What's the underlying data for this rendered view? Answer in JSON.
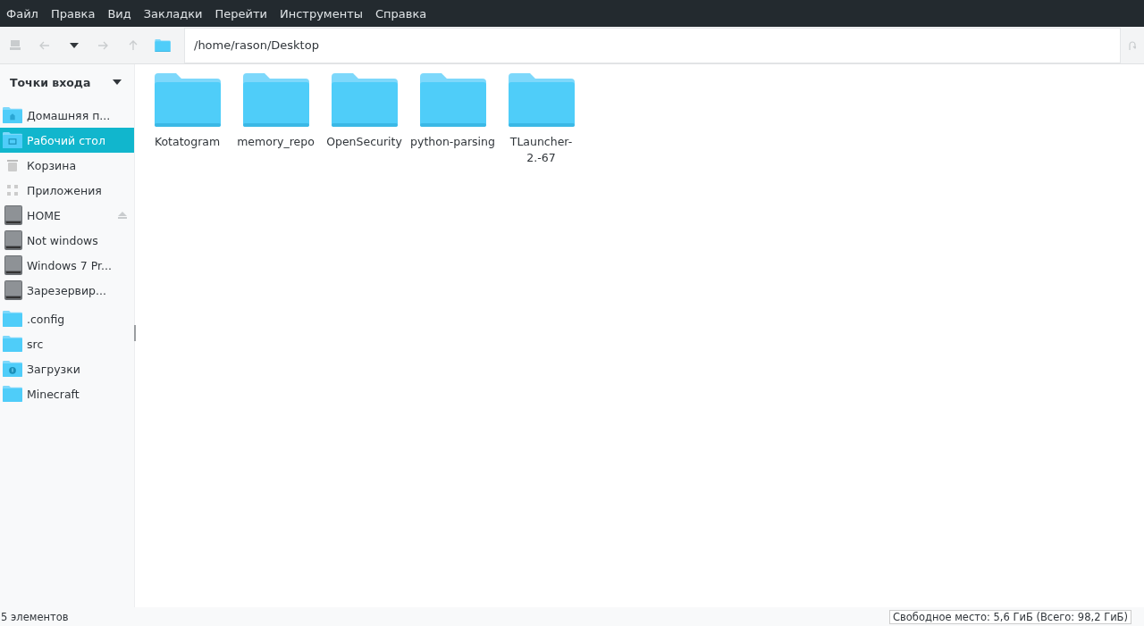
{
  "menu": [
    "Файл",
    "Правка",
    "Вид",
    "Закладки",
    "Перейти",
    "Инструменты",
    "Справка"
  ],
  "toolbar": {
    "path": "/home/rason/Desktop"
  },
  "sidebar": {
    "title": "Точки входа",
    "items": [
      {
        "label": "Домашняя п...",
        "kind": "home",
        "selected": false,
        "ejectable": false
      },
      {
        "label": "Рабочий стол",
        "kind": "desktop",
        "selected": true,
        "ejectable": false
      },
      {
        "label": "Корзина",
        "kind": "trash",
        "selected": false,
        "ejectable": false
      },
      {
        "label": "Приложения",
        "kind": "apps",
        "selected": false,
        "ejectable": false
      },
      {
        "label": "HOME",
        "kind": "drive",
        "selected": false,
        "ejectable": true
      },
      {
        "label": "Not windows",
        "kind": "drive",
        "selected": false,
        "ejectable": false
      },
      {
        "label": "Windows 7 Pr...",
        "kind": "drive",
        "selected": false,
        "ejectable": false
      },
      {
        "label": "Зарезервир...",
        "kind": "drive",
        "selected": false,
        "ejectable": false
      },
      {
        "label": ".config",
        "kind": "folder",
        "selected": false,
        "ejectable": false
      },
      {
        "label": "src",
        "kind": "folder",
        "selected": false,
        "ejectable": false
      },
      {
        "label": "Загрузки",
        "kind": "downloads",
        "selected": false,
        "ejectable": false
      },
      {
        "label": "Minecraft",
        "kind": "folder",
        "selected": false,
        "ejectable": false
      }
    ]
  },
  "files": [
    {
      "name": "Kotatogram"
    },
    {
      "name": "memory_repo"
    },
    {
      "name": "OpenSecurity"
    },
    {
      "name": "python-parsing"
    },
    {
      "name": "TLauncher-2.-67"
    }
  ],
  "status_bar": {
    "count": "5 элементов",
    "free_space": "Свободное место: 5,6 ГиБ (Всего: 98,2 ГиБ)"
  }
}
